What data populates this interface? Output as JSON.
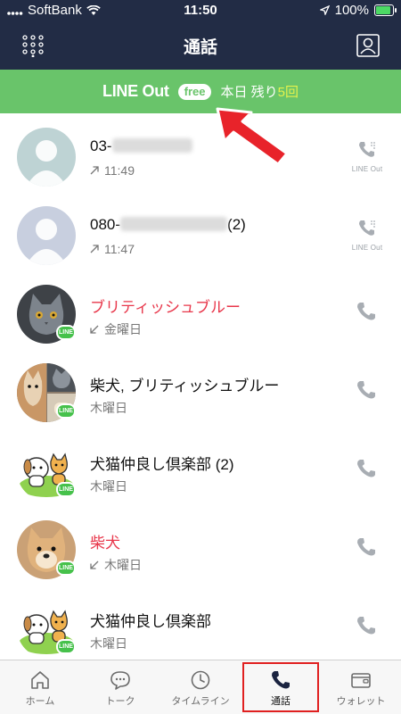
{
  "status_bar": {
    "carrier": "SoftBank",
    "time": "11:50",
    "battery": "100%",
    "battery_level": 1.0
  },
  "header": {
    "title": "通話",
    "dialpad_icon": "dialpad-icon",
    "profile_icon": "contact-card-icon"
  },
  "banner": {
    "brand": "LINE Out",
    "badge": "free",
    "remaining_prefix": "本日 残り",
    "remaining_count": "5回"
  },
  "calls": [
    {
      "name_prefix": "03-",
      "name_suffix": "",
      "detail": "11:49",
      "direction": "outgoing",
      "avatar": "placeholder",
      "call_type": "lineout"
    },
    {
      "name_prefix": "080-",
      "name_suffix": "(2)",
      "detail": "11:47",
      "direction": "outgoing",
      "avatar": "placeholder",
      "call_type": "lineout"
    },
    {
      "name": "ブリティッシュブルー",
      "detail": "金曜日",
      "direction": "missed",
      "avatar": "cat",
      "highlight": true,
      "call_type": "line"
    },
    {
      "name": "柴犬, ブリティッシュブルー",
      "detail": "木曜日",
      "direction": "",
      "avatar": "group",
      "highlight": false,
      "call_type": "line"
    },
    {
      "name": "犬猫仲良し倶楽部 (2)",
      "detail": "木曜日",
      "direction": "",
      "avatar": "pets",
      "highlight": false,
      "call_type": "line"
    },
    {
      "name": "柴犬",
      "detail": "木曜日",
      "direction": "missed",
      "avatar": "dog",
      "highlight": true,
      "call_type": "line"
    },
    {
      "name": "犬猫仲良し倶楽部",
      "detail": "木曜日",
      "direction": "",
      "avatar": "pets",
      "highlight": false,
      "call_type": "line"
    }
  ],
  "badges": {
    "line": "LINE",
    "lineout": "LINE Out"
  },
  "tabs": [
    {
      "label": "ホーム",
      "icon": "home-icon"
    },
    {
      "label": "トーク",
      "icon": "chat-icon"
    },
    {
      "label": "タイムライン",
      "icon": "clock-icon"
    },
    {
      "label": "通話",
      "icon": "phone-icon",
      "active": true
    },
    {
      "label": "ウォレット",
      "icon": "wallet-icon"
    }
  ],
  "colors": {
    "header_bg": "#222c45",
    "banner_bg": "#69c46a",
    "accent_red": "#e8374b",
    "highlight_box": "#e02020"
  }
}
